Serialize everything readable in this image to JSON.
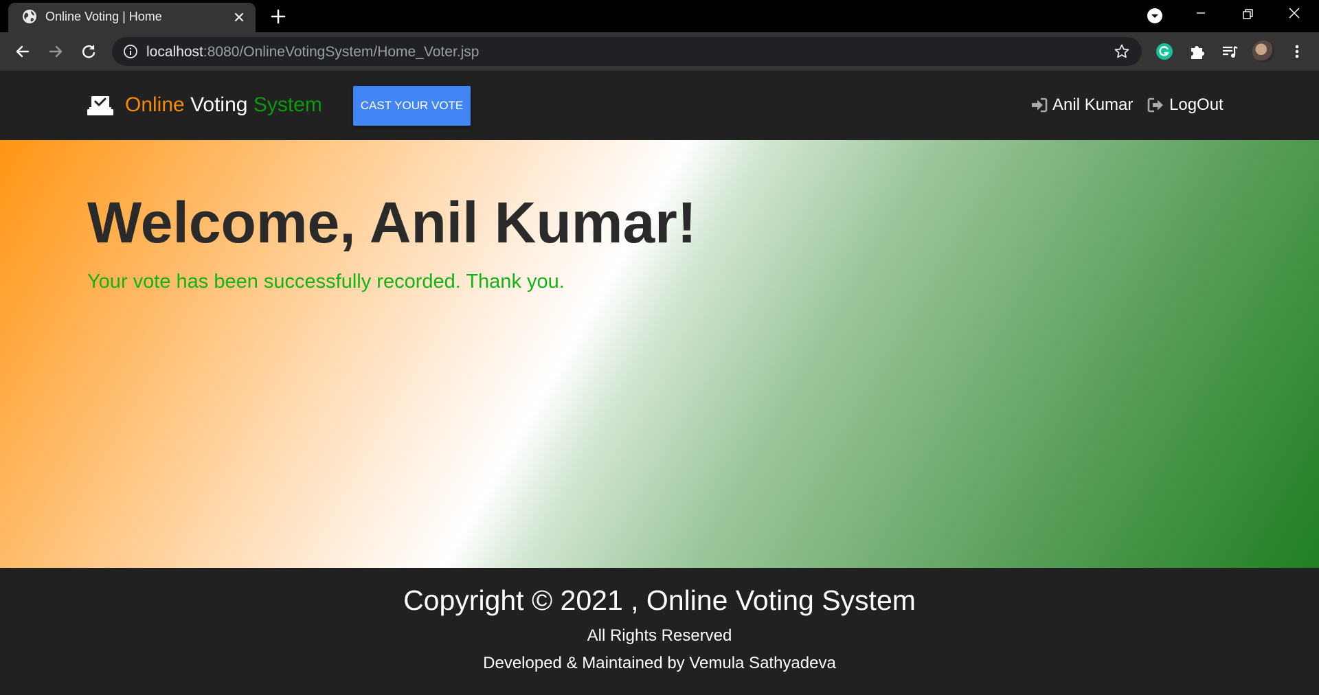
{
  "browser": {
    "tab_title": "Online Voting | Home",
    "url_host": "localhost",
    "url_path": ":8080/OnlineVotingSystem/Home_Voter.jsp"
  },
  "icons": {
    "favicon": "globe-icon",
    "tab_close": "close-icon",
    "new_tab": "plus-icon",
    "back": "arrow-left-icon",
    "forward": "arrow-right-icon",
    "reload": "reload-icon",
    "site_info": "info-icon",
    "bookmark": "star-icon",
    "grammarly": "grammarly-icon",
    "extensions": "puzzle-icon",
    "media": "playlist-icon",
    "menu": "kebab-menu-icon",
    "brand": "ballot-box-icon",
    "signin": "sign-in-icon",
    "logout": "sign-out-icon"
  },
  "navbar": {
    "brand_part1": "Online",
    "brand_part2": "Voting",
    "brand_part3": "System",
    "cast_vote_label": "CAST YOUR VOTE",
    "user_name": "Anil Kumar",
    "logout_label": "LogOut"
  },
  "hero": {
    "heading": "Welcome, Anil Kumar!",
    "message": "Your vote has been successfully recorded. Thank you."
  },
  "footer": {
    "copyright": "Copyright © 2021 , Online Voting System",
    "rights": "All Rights Reserved",
    "developer": "Developed & Maintained by Vemula Sathyadeva"
  },
  "colors": {
    "brand_orange": "#f58b0b",
    "brand_green": "#0c9b0c",
    "cast_button": "#4285f4",
    "success_text": "#12b312",
    "navbar_bg": "#212121"
  }
}
